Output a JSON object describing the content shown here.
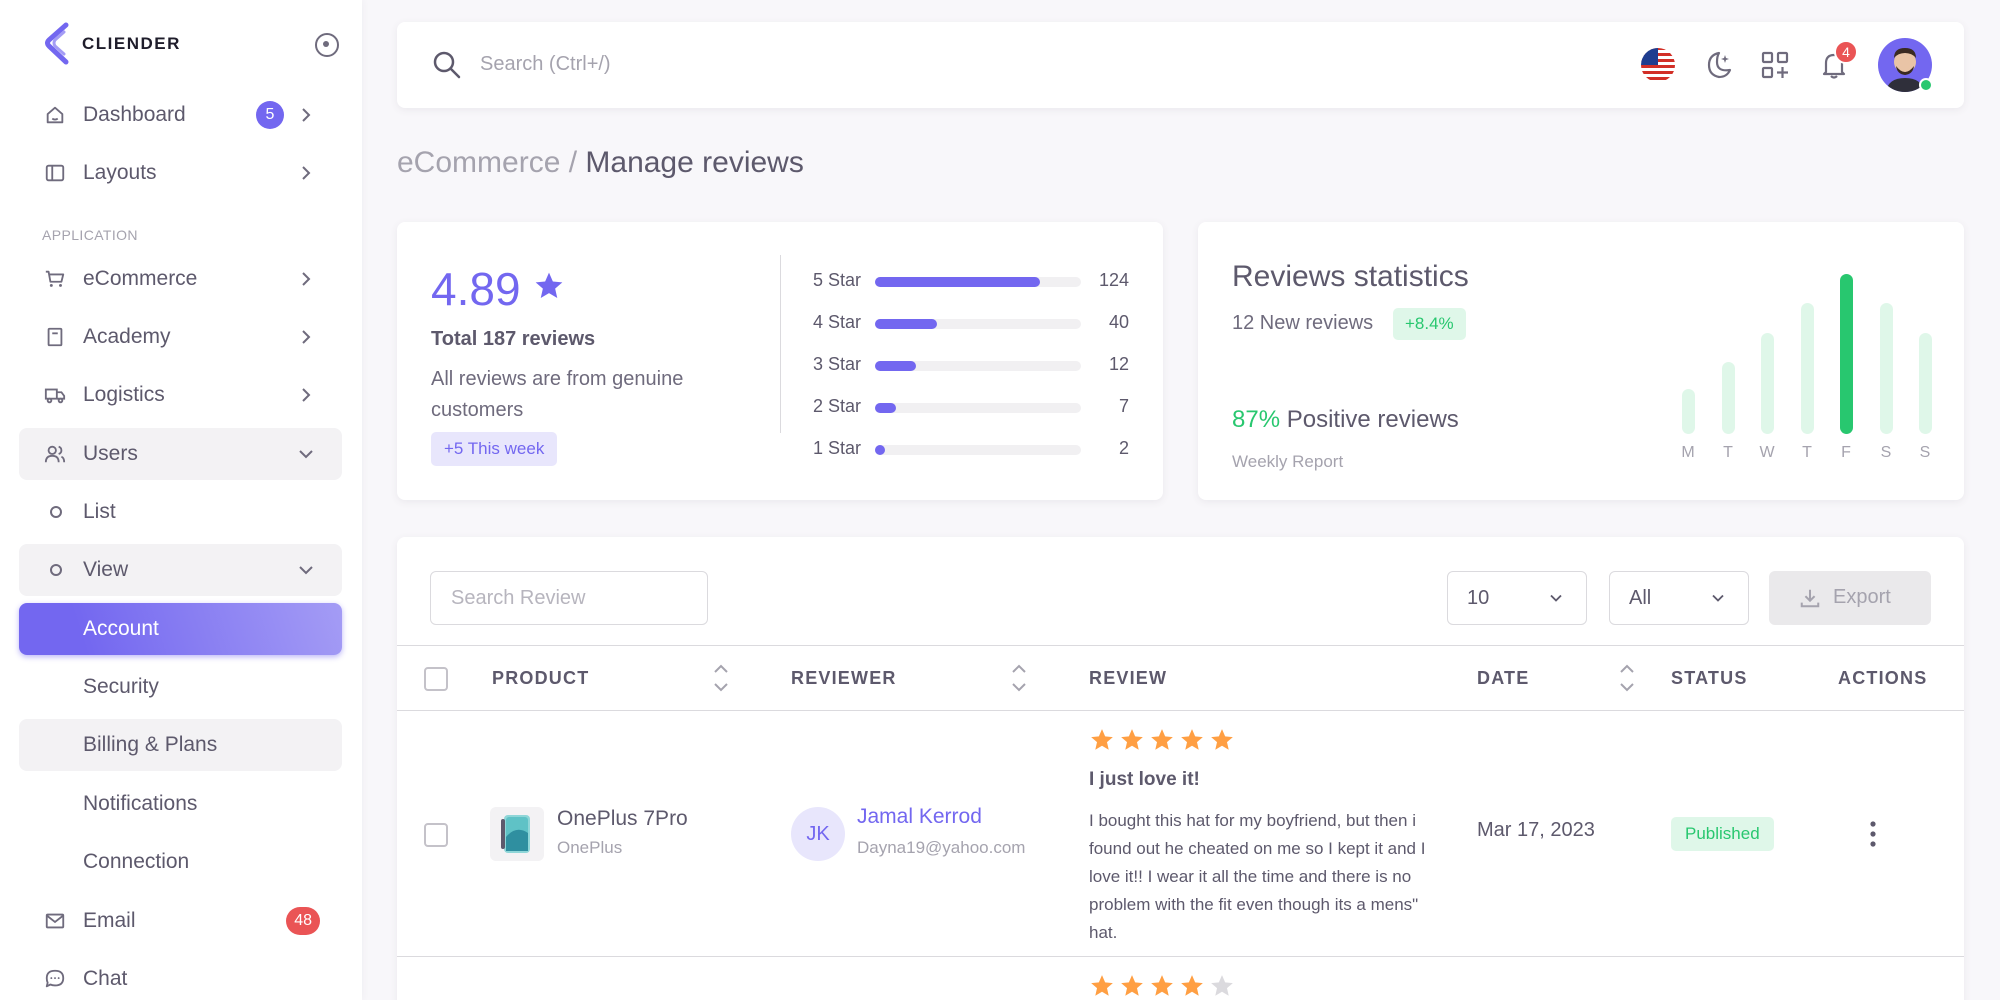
{
  "brand": {
    "name": "CLIENDER"
  },
  "sidebar": {
    "section_application": "APPLICATION",
    "items": {
      "dashboard": {
        "label": "Dashboard",
        "badge": "5"
      },
      "layouts": {
        "label": "Layouts"
      },
      "ecommerce": {
        "label": "eCommerce"
      },
      "academy": {
        "label": "Academy"
      },
      "logistics": {
        "label": "Logistics"
      },
      "users": {
        "label": "Users"
      },
      "list": {
        "label": "List"
      },
      "view": {
        "label": "View"
      },
      "account": {
        "label": "Account"
      },
      "security": {
        "label": "Security"
      },
      "billing": {
        "label": "Billing & Plans"
      },
      "notifications": {
        "label": "Notifications"
      },
      "connection": {
        "label": "Connection"
      },
      "email": {
        "label": "Email",
        "badge": "48"
      },
      "chat": {
        "label": "Chat"
      }
    }
  },
  "navbar": {
    "search_placeholder": "Search (Ctrl+/)",
    "notification_count": "4",
    "icons": [
      "us-flag-icon",
      "moon-icon",
      "apps-grid-icon",
      "bell-icon"
    ]
  },
  "breadcrumb": {
    "parent": "eCommerce /",
    "current": "Manage reviews"
  },
  "rating_card": {
    "average": "4.89",
    "total_label": "Total 187 reviews",
    "description": "All reviews are from genuine customers",
    "week_chip": "+5 This week",
    "distribution": [
      {
        "label": "5 Star",
        "count": "124",
        "fraction": 0.8
      },
      {
        "label": "4 Star",
        "count": "40",
        "fraction": 0.3
      },
      {
        "label": "3 Star",
        "count": "12",
        "fraction": 0.2
      },
      {
        "label": "2 Star",
        "count": "7",
        "fraction": 0.1
      },
      {
        "label": "1 Star",
        "count": "2",
        "fraction": 0.05
      }
    ]
  },
  "stats_card": {
    "title": "Reviews statistics",
    "new_reviews": "12 New reviews",
    "change_chip": "+8.4%",
    "positive_pct": "87%",
    "positive_label": "Positive reviews",
    "weekly_report": "Weekly Report",
    "days": [
      "M",
      "T",
      "W",
      "T",
      "F",
      "S",
      "S"
    ],
    "bar_levels": [
      0.28,
      0.45,
      0.63,
      0.82,
      1.0,
      0.82,
      0.63
    ],
    "highlight_color": "#28c76f",
    "base_color": "#dff7e9"
  },
  "table": {
    "search_placeholder": "Search Review",
    "page_size": "10",
    "filter": "All",
    "export_label": "Export",
    "headers": {
      "product": "PRODUCT",
      "reviewer": "REVIEWER",
      "review": "REVIEW",
      "date": "DATE",
      "status": "STATUS",
      "actions": "ACTIONS"
    },
    "rows": [
      {
        "product_name": "OnePlus 7Pro",
        "product_brand": "OnePlus",
        "reviewer_initials": "JK",
        "reviewer_name": "Jamal Kerrod",
        "reviewer_email": "Dayna19@yahoo.com",
        "rating": 5,
        "title": "I just love it!",
        "body": "I bought this hat for my boyfriend, but then i found out he cheated on me so I kept it and I love it!! I wear it all the time and there is no problem with the fit even though its a mens\" hat.",
        "date": "Mar 17, 2023",
        "status": "Published"
      },
      {
        "rating": 4
      }
    ]
  },
  "colors": {
    "primary": "#7367f0",
    "success": "#28c76f",
    "danger": "#ea5455",
    "star": "#ff9f43"
  }
}
